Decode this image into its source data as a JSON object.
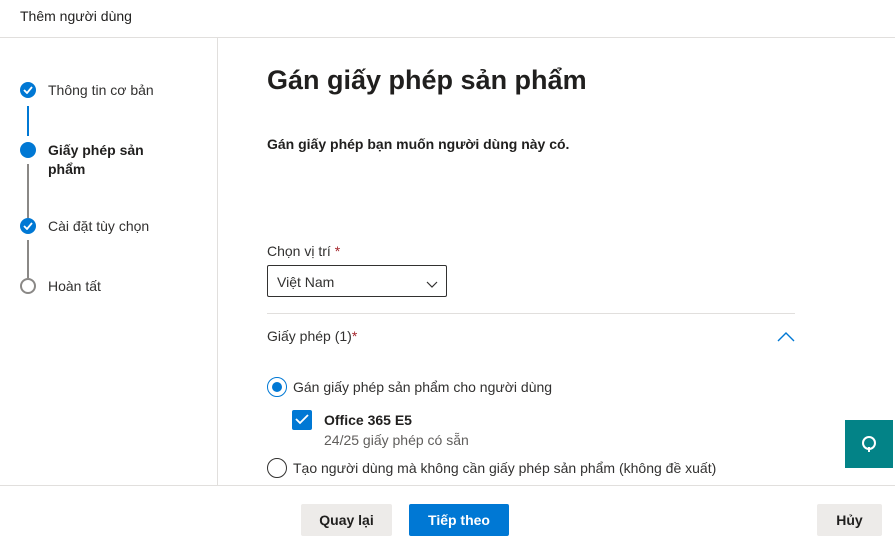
{
  "header": {
    "title": "Thêm người dùng"
  },
  "steps": [
    {
      "label": "Thông tin cơ bản",
      "state": "done"
    },
    {
      "label": "Giấy phép sản phẩm",
      "state": "current"
    },
    {
      "label": "Cài đặt tùy chọn",
      "state": "done"
    },
    {
      "label": "Hoàn tất",
      "state": "todo"
    }
  ],
  "main": {
    "title": "Gán giấy phép sản phẩm",
    "description": "Gán giấy phép bạn muốn người dùng này có.",
    "location": {
      "label": "Chọn vị trí",
      "required_mark": "*",
      "value": "Việt Nam"
    },
    "licenses": {
      "label": "Giấy phép (1)",
      "required_mark": "*",
      "options": [
        {
          "label": "Gán giấy phép sản phẩm cho người dùng",
          "selected": true
        },
        {
          "label": "Tạo người dùng mà không cần giấy phép sản phẩm (không đề xuất)",
          "selected": false
        }
      ],
      "product": {
        "name": "Office 365 E5",
        "availability": "24/25 giấy phép có sẵn",
        "checked": true
      }
    }
  },
  "footer": {
    "back_label": "Quay lại",
    "next_label": "Tiếp theo",
    "cancel_label": "Hủy"
  },
  "colors": {
    "accent": "#0078d4",
    "help_fab": "#038387",
    "required": "#a4262c"
  },
  "icons": {
    "step_done": "checkmark-icon",
    "select": "chevron-down-icon",
    "section": "chevron-up-icon",
    "help": "help-icon"
  }
}
